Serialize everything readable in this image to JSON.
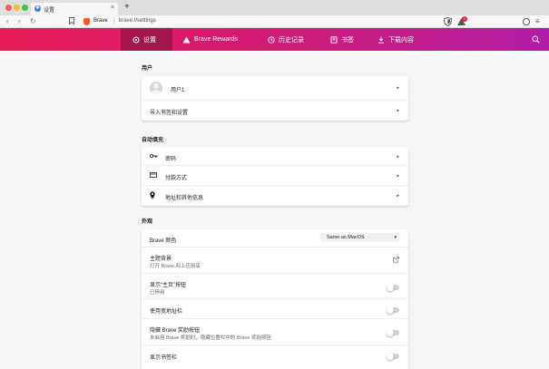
{
  "tab": {
    "title": "设置",
    "favicon_icon": "gear-icon"
  },
  "address": {
    "brand": "Brave",
    "separator": "|",
    "url": "brave://settings"
  },
  "rewards_badge": "1",
  "header": {
    "items": [
      {
        "label": "设置",
        "icon": "gear-icon",
        "active": true
      },
      {
        "label": "Brave Rewards",
        "icon": "triangle-icon"
      },
      {
        "label": "历史记录",
        "icon": "history-icon"
      },
      {
        "label": "书签",
        "icon": "bookmark-icon"
      },
      {
        "label": "下载内容",
        "icon": "download-icon"
      }
    ]
  },
  "sections": {
    "people": {
      "title": "用户",
      "profile_name": "用户1",
      "import_label": "导入书签和设置"
    },
    "autofill": {
      "title": "自动填充",
      "passwords": "密码",
      "payment": "付款方式",
      "addresses": "地址和其他信息"
    },
    "appearance": {
      "title": "外观",
      "brave_colors_label": "Brave 颜色",
      "brave_colors_value": "Same as MacOS",
      "theme_label": "主题背景",
      "theme_sub": "打开 Brave 网上应用店",
      "home_button_label": "显示“主页”按钮",
      "home_button_sub": "已停用",
      "wide_address_label": "使用宽地址栏",
      "hide_rewards_label": "隐藏 Brave 奖励按钮",
      "hide_rewards_sub": "未启用 Brave 奖励时，隐藏位置栏中的 Brave 奖励按钮",
      "bookmarks_bar_label": "显示书签栏"
    }
  },
  "colors": {
    "header_start": "#e61d56",
    "header_end": "#b11ca6",
    "active_item": "#a3164b"
  }
}
